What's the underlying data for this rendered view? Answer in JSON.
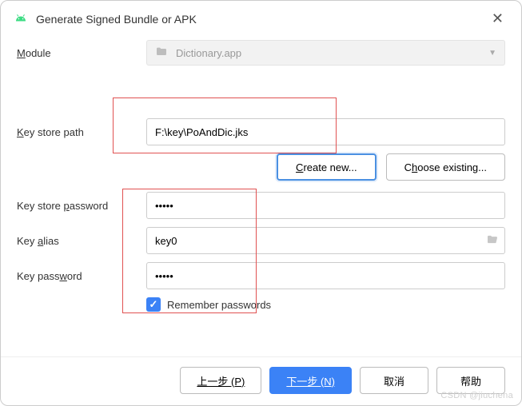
{
  "title": "Generate Signed Bundle or APK",
  "module": {
    "label_pre": "M",
    "label_rest": "odule",
    "value": "Dictionary.app"
  },
  "keystore": {
    "path_label_pre": "K",
    "path_label_rest": "ey store path",
    "path_value": "F:\\key\\PoAndDic.jks",
    "create_pre": "C",
    "create_rest": "reate new...",
    "choose_pre_text": "C",
    "choose_u": "h",
    "choose_rest": "oose existing...",
    "pwd_label_pre": "Key store ",
    "pwd_label_u": "p",
    "pwd_label_rest": "assword",
    "pwd_value": "•••••"
  },
  "key": {
    "alias_label_pre": "Key ",
    "alias_label_u": "a",
    "alias_label_rest": "lias",
    "alias_value": "key0",
    "pwd_label_pre": "Key pass",
    "pwd_label_u": "w",
    "pwd_label_rest": "ord",
    "pwd_value": "•••••"
  },
  "remember": {
    "checked": true,
    "label_u": "R",
    "label_rest": "emember passwords"
  },
  "footer": {
    "prev": "上一步 (P)",
    "next": "下一步 (N)",
    "cancel": "取消",
    "help": "帮助"
  },
  "watermark": "CSDN @jiuchena"
}
